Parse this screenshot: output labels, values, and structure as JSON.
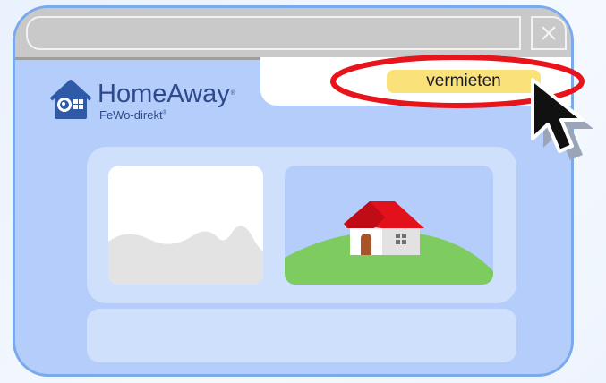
{
  "brand": {
    "name": "HomeAway",
    "sub": "FeWo-direkt",
    "mark": "®"
  },
  "header": {
    "rent_button_label": "vermieten"
  },
  "icons": {
    "close": "close-icon",
    "logo": "homeaway-logo-icon",
    "cursor": "mouse-pointer-icon",
    "house": "house-icon",
    "image": "image-placeholder-icon"
  },
  "colors": {
    "window_bg": "#b4cdfb",
    "window_border": "#7aa9ec",
    "titlebar": "#c9c9c9",
    "panel": "#cfe0fc",
    "button": "#fbe17a",
    "highlight": "#e8141c",
    "brand": "#2e4a8c",
    "roof": "#e3111b",
    "hill": "#7ecb5f"
  }
}
